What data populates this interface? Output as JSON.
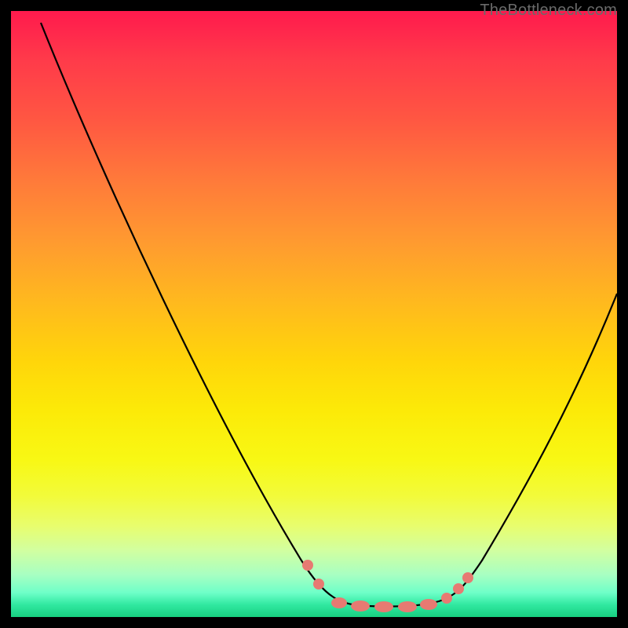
{
  "watermark": "TheBottleneck.com",
  "chart_data": {
    "type": "line",
    "title": "",
    "xlabel": "",
    "ylabel": "",
    "xlim": [
      0,
      100
    ],
    "ylim": [
      0,
      100
    ],
    "background_gradient": {
      "top": "#ff1a4d",
      "mid": "#ffd60a",
      "bottom": "#18d080"
    },
    "series": [
      {
        "name": "bottleneck-curve",
        "color": "#000000",
        "x": [
          5,
          10,
          15,
          20,
          25,
          30,
          35,
          40,
          45,
          50,
          53,
          56,
          60,
          64,
          68,
          72,
          76,
          80,
          84,
          88,
          92,
          96,
          100
        ],
        "y": [
          98,
          88,
          79,
          70,
          61,
          52,
          43,
          34,
          25,
          14,
          6,
          2,
          0,
          0,
          0,
          0,
          2,
          6,
          14,
          24,
          35,
          46,
          58
        ]
      }
    ],
    "markers": {
      "name": "optimal-range-dots",
      "color": "#e77a72",
      "x": [
        49,
        51,
        54,
        57,
        60,
        63,
        66,
        69,
        71,
        73,
        75
      ],
      "y": [
        7,
        4,
        1,
        0,
        0,
        0,
        0,
        0,
        1,
        3,
        6
      ]
    }
  }
}
